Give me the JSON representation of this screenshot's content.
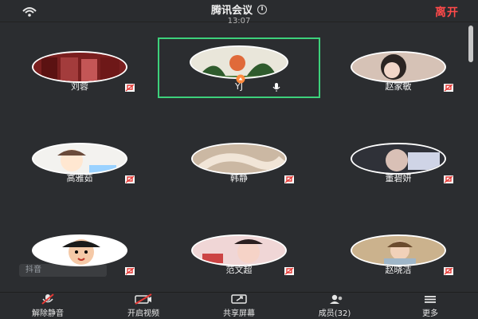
{
  "header": {
    "title": "腾讯会议",
    "time": "13:07",
    "leave_label": "离开",
    "info_icon": "info-icon",
    "signal_icon": "signal-icon",
    "leave_color": "#ff4a4a"
  },
  "participants": [
    {
      "name": "刘蓉",
      "active": false,
      "mic": "muted"
    },
    {
      "name": "YJ",
      "active": true,
      "mic": "on"
    },
    {
      "name": "赵家敏",
      "active": false,
      "mic": "muted"
    },
    {
      "name": "高雅茹",
      "active": false,
      "mic": "muted"
    },
    {
      "name": "韩静",
      "active": false,
      "mic": "muted"
    },
    {
      "name": "董碧妍",
      "active": false,
      "mic": "muted"
    },
    {
      "name": "",
      "active": false,
      "mic": "muted"
    },
    {
      "name": "范文超",
      "active": false,
      "mic": "muted"
    },
    {
      "name": "赵晓洁",
      "active": false,
      "mic": "muted"
    }
  ],
  "pager": {
    "count": 4,
    "active_index": 0
  },
  "watermark": {
    "text": "抖音"
  },
  "bottom_bar": {
    "items": [
      {
        "label": "解除静音",
        "icon": "mic-muted-icon"
      },
      {
        "label": "开启视频",
        "icon": "camera-off-icon"
      },
      {
        "label": "共享屏幕",
        "icon": "share-screen-icon"
      },
      {
        "label": "成员(32)",
        "icon": "members-icon"
      },
      {
        "label": "更多",
        "icon": "more-icon"
      }
    ]
  },
  "colors": {
    "background": "#2b2d30",
    "active_outline": "#3dd17b",
    "mute_red": "#e53935"
  }
}
